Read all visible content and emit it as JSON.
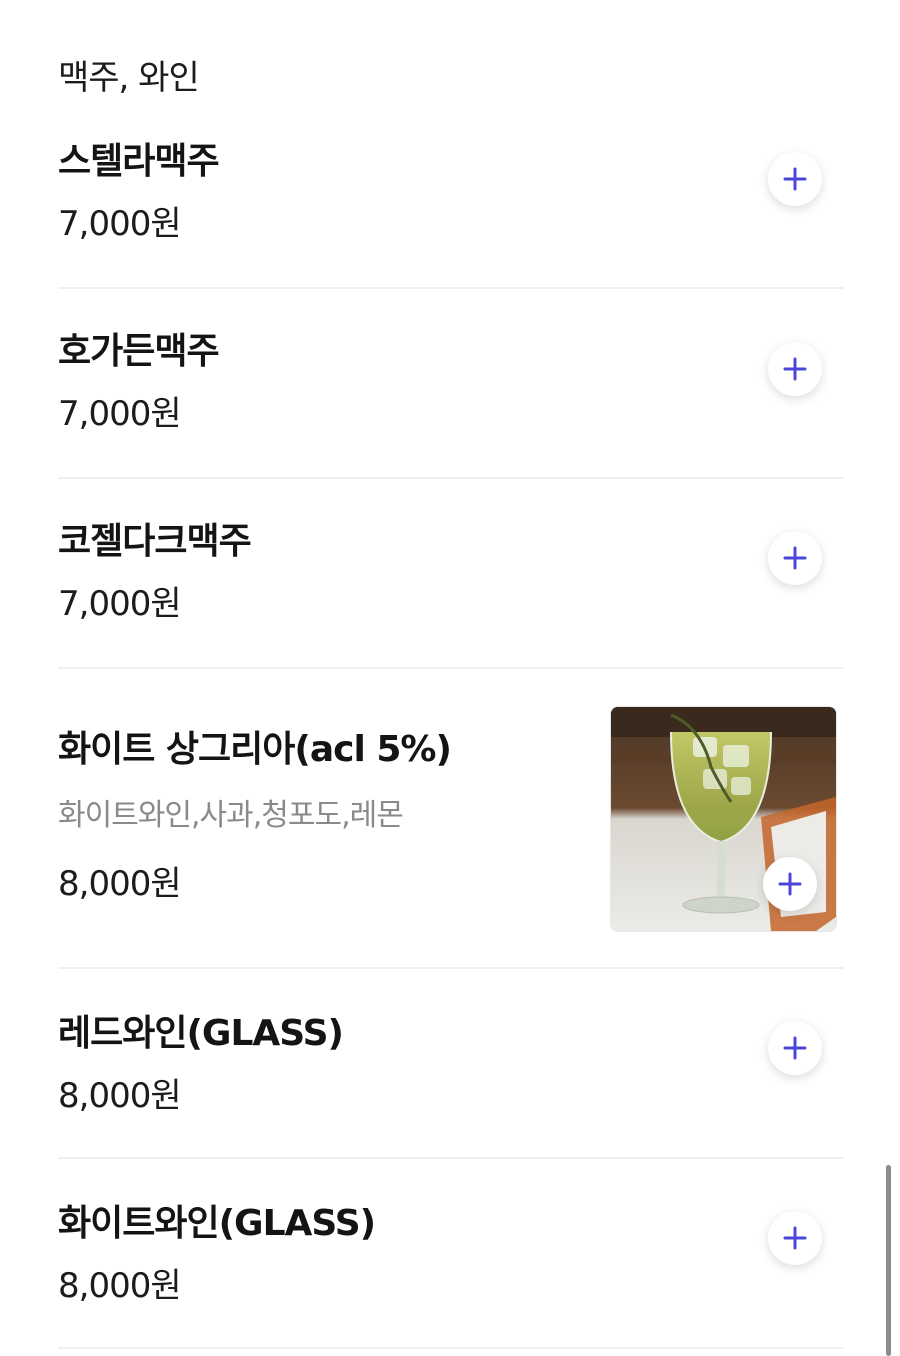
{
  "category": "맥주, 와인",
  "accent_color": "#4b45d8",
  "items": [
    {
      "name": "스텔라맥주",
      "price": "7,000원",
      "add_icon": "plus-icon"
    },
    {
      "name": "호가든맥주",
      "price": "7,000원",
      "add_icon": "plus-icon"
    },
    {
      "name": "코젤다크맥주",
      "price": "7,000원",
      "add_icon": "plus-icon"
    },
    {
      "name": "화이트 상그리아(acl 5%)",
      "description": "화이트와인,사과,청포도,레몬",
      "price": "8,000원",
      "image": "sangria-glass-photo",
      "add_icon": "plus-icon"
    },
    {
      "name": "레드와인(GLASS)",
      "price": "8,000원",
      "add_icon": "plus-icon"
    },
    {
      "name": "화이트와인(GLASS)",
      "price": "8,000원",
      "add_icon": "plus-icon"
    }
  ]
}
